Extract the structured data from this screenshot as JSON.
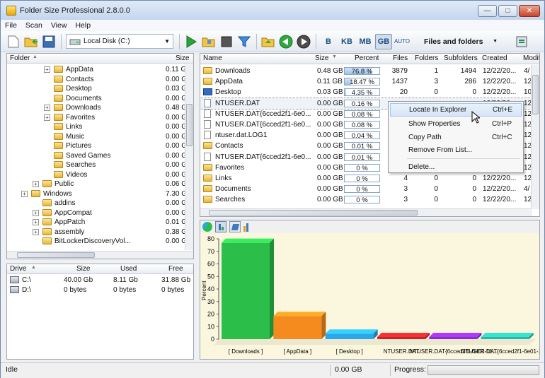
{
  "window": {
    "title": "Folder Size Professional 2.8.0.0",
    "controls": [
      "minimize",
      "maximize",
      "close"
    ]
  },
  "menu": [
    "File",
    "Scan",
    "View",
    "Help"
  ],
  "toolbar": {
    "drive": "Local Disk (C:)",
    "units": [
      "B",
      "KB",
      "MB",
      "GB",
      "AUTO"
    ],
    "selected_unit": "GB",
    "view_mode": "Files and folders"
  },
  "tree": {
    "headers": {
      "folder": "Folder",
      "size": "Size"
    },
    "rows": [
      {
        "name": "AppData",
        "size": "0.11 G",
        "indent": 3,
        "expander": true
      },
      {
        "name": "Contacts",
        "size": "0.00 G",
        "indent": 3,
        "expander": false
      },
      {
        "name": "Desktop",
        "size": "0.03 G",
        "indent": 3,
        "expander": false
      },
      {
        "name": "Documents",
        "size": "0.00 G",
        "indent": 3,
        "expander": false
      },
      {
        "name": "Downloads",
        "size": "0.48 G",
        "indent": 3,
        "expander": true
      },
      {
        "name": "Favorites",
        "size": "0.00 G",
        "indent": 3,
        "expander": true
      },
      {
        "name": "Links",
        "size": "0.00 G",
        "indent": 3,
        "expander": false
      },
      {
        "name": "Music",
        "size": "0.00 G",
        "indent": 3,
        "expander": false
      },
      {
        "name": "Pictures",
        "size": "0.00 G",
        "indent": 3,
        "expander": false
      },
      {
        "name": "Saved Games",
        "size": "0.00 G",
        "indent": 3,
        "expander": false
      },
      {
        "name": "Searches",
        "size": "0.00 G",
        "indent": 3,
        "expander": false
      },
      {
        "name": "Videos",
        "size": "0.00 G",
        "indent": 3,
        "expander": false
      },
      {
        "name": "Public",
        "size": "0.06 G",
        "indent": 2,
        "expander": true
      },
      {
        "name": "Windows",
        "size": "7.30 G",
        "indent": 1,
        "expander": true
      },
      {
        "name": "addins",
        "size": "0.00 G",
        "indent": 2,
        "expander": false
      },
      {
        "name": "AppCompat",
        "size": "0.00 G",
        "indent": 2,
        "expander": true
      },
      {
        "name": "AppPatch",
        "size": "0.01 G",
        "indent": 2,
        "expander": true
      },
      {
        "name": "assembly",
        "size": "0.38 G",
        "indent": 2,
        "expander": true
      },
      {
        "name": "BitLockerDiscoveryVol...",
        "size": "0.00 G",
        "indent": 2,
        "expander": false
      }
    ]
  },
  "drives": {
    "headers": {
      "drive": "Drive",
      "size": "Size",
      "used": "Used",
      "free": "Free"
    },
    "rows": [
      {
        "drive": "C:\\",
        "size": "40.00 Gb",
        "used": "8.11 Gb",
        "free": "31.88 Gb"
      },
      {
        "drive": "D:\\",
        "size": "0 bytes",
        "used": "0 bytes",
        "free": "0 bytes"
      }
    ]
  },
  "files": {
    "headers": {
      "name": "Name",
      "size": "Size",
      "percent": "Percent",
      "files": "Files",
      "folders": "Folders",
      "subfolders": "Subfolders",
      "created": "Created",
      "modified": "Modifi"
    },
    "rows": [
      {
        "name": "Downloads",
        "kind": "folder",
        "size": "0.48 GB",
        "percent": "76.8 %",
        "pct": 76.8,
        "files": "3879",
        "folders": "1",
        "subfolders": "1494",
        "created": "12/22/20...",
        "modified": "4/"
      },
      {
        "name": "AppData",
        "kind": "folder",
        "size": "0.11 GB",
        "percent": "18.47 %",
        "pct": 18.47,
        "files": "1437",
        "folders": "3",
        "subfolders": "286",
        "created": "12/22/20...",
        "modified": "12"
      },
      {
        "name": "Desktop",
        "kind": "desktop",
        "size": "0.03 GB",
        "percent": "4.35 %",
        "pct": 4.35,
        "files": "20",
        "folders": "0",
        "subfolders": "0",
        "created": "12/22/20...",
        "modified": "10"
      },
      {
        "name": "NTUSER.DAT",
        "kind": "file",
        "size": "0.00 GB",
        "percent": "0.16 %",
        "pct": 0.16,
        "files": "",
        "folders": "",
        "subfolders": "",
        "created": "12/22/20...",
        "modified": "12"
      },
      {
        "name": "NTUSER.DAT{6cced2f1-6e0...",
        "kind": "file",
        "size": "0.00 GB",
        "percent": "0.08 %",
        "pct": 0.08,
        "files": "",
        "folders": "",
        "subfolders": "",
        "created": "",
        "modified": "12"
      },
      {
        "name": "NTUSER.DAT{6cced2f1-6e0...",
        "kind": "file",
        "size": "0.00 GB",
        "percent": "0.08 %",
        "pct": 0.08,
        "files": "",
        "folders": "",
        "subfolders": "",
        "created": "",
        "modified": "12"
      },
      {
        "name": "ntuser.dat.LOG1",
        "kind": "file",
        "size": "0.00 GB",
        "percent": "0.04 %",
        "pct": 0.04,
        "files": "",
        "folders": "",
        "subfolders": "",
        "created": "",
        "modified": "12"
      },
      {
        "name": "Contacts",
        "kind": "folder",
        "size": "0.00 GB",
        "percent": "0.01 %",
        "pct": 0.01,
        "files": "",
        "folders": "",
        "subfolders": "",
        "created": "",
        "modified": "12"
      },
      {
        "name": "NTUSER.DAT{6cced2f1-6e0...",
        "kind": "file",
        "size": "0.00 GB",
        "percent": "0.01 %",
        "pct": 0.01,
        "files": "",
        "folders": "",
        "subfolders": "",
        "created": "",
        "modified": "12"
      },
      {
        "name": "Favorites",
        "kind": "folder",
        "size": "0.00 GB",
        "percent": "0 %",
        "pct": 0,
        "files": "",
        "folders": "",
        "subfolders": "",
        "created": "",
        "modified": "12"
      },
      {
        "name": "Links",
        "kind": "folder",
        "size": "0.00 GB",
        "percent": "0 %",
        "pct": 0,
        "files": "4",
        "folders": "0",
        "subfolders": "0",
        "created": "12/22/20...",
        "modified": "12"
      },
      {
        "name": "Documents",
        "kind": "folder",
        "size": "0.00 GB",
        "percent": "0 %",
        "pct": 0,
        "files": "3",
        "folders": "0",
        "subfolders": "0",
        "created": "12/22/20...",
        "modified": "4/"
      },
      {
        "name": "Searches",
        "kind": "folder",
        "size": "0.00 GB",
        "percent": "0 %",
        "pct": 0,
        "files": "3",
        "folders": "0",
        "subfolders": "0",
        "created": "12/22/20...",
        "modified": "12"
      }
    ]
  },
  "context_menu": {
    "items": [
      {
        "label": "Locate In Explorer",
        "shortcut": "Ctrl+E"
      },
      {
        "label": "Show Properties",
        "shortcut": "Ctrl+P"
      },
      {
        "label": "Copy Path",
        "shortcut": "Ctrl+C"
      },
      {
        "label": "Remove From List...",
        "shortcut": ""
      },
      {
        "label": "Delete...",
        "shortcut": ""
      }
    ]
  },
  "chart_data": {
    "type": "bar",
    "title": "",
    "ylabel": "Percent",
    "xlabel": "",
    "ylim": [
      0,
      80
    ],
    "yticks": [
      0,
      10,
      20,
      30,
      40,
      50,
      60,
      70,
      80
    ],
    "categories": [
      "[ Downloads ]",
      "[ AppData ]",
      "[ Desktop ]",
      "NTUSER.DAT",
      "NTUSER.DAT{6cced2f1-6e01-11...",
      "NTUSER.DAT{6cced2f1-6e01-11..."
    ],
    "values": [
      76.8,
      18.47,
      4.35,
      0.16,
      0.08,
      0.08
    ],
    "colors": [
      "#2bbf4a",
      "#f58a1f",
      "#2aa7ea",
      "#c7272a",
      "#8b2fc9",
      "#2ab7a8"
    ]
  },
  "status": {
    "text": "Idle",
    "size": "0.00 GB",
    "progress_label": "Progress:"
  },
  "colors": {
    "accent": "#2f74c3",
    "chart_bg": "#fbf7de"
  }
}
